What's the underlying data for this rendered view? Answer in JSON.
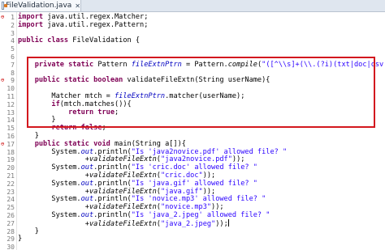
{
  "editor": {
    "tab": {
      "label": "FileValidation.java",
      "close_glyph": "✕"
    },
    "lines": [
      {
        "num": "1",
        "marker": "⊖",
        "tokens": [
          {
            "t": "import ",
            "c": "kw"
          },
          {
            "t": "java.util.regex.Matcher;",
            "c": ""
          }
        ]
      },
      {
        "num": "2",
        "marker": "",
        "tokens": [
          {
            "t": "import ",
            "c": "kw"
          },
          {
            "t": "java.util.regex.Pattern;",
            "c": ""
          }
        ]
      },
      {
        "num": "3",
        "marker": "",
        "tokens": []
      },
      {
        "num": "4",
        "marker": "",
        "tokens": [
          {
            "t": "public class ",
            "c": "kw"
          },
          {
            "t": "FileValidation {",
            "c": ""
          }
        ]
      },
      {
        "num": "5",
        "marker": "",
        "tokens": []
      },
      {
        "num": "6",
        "marker": "",
        "tokens": []
      },
      {
        "num": "7",
        "marker": "",
        "tokens": [
          {
            "t": "    private static ",
            "c": "kw"
          },
          {
            "t": "Pattern ",
            "c": ""
          },
          {
            "t": "fileExtnPtrn",
            "c": "fld"
          },
          {
            "t": " = Pattern.",
            "c": ""
          },
          {
            "t": "compile",
            "c": "stat"
          },
          {
            "t": "(",
            "c": ""
          },
          {
            "t": "\"([^\\\\s]+(\\\\.(?i)(txt|doc|csv|pdf))$)\"",
            "c": "str"
          },
          {
            "t": ");",
            "c": ""
          }
        ]
      },
      {
        "num": "8",
        "marker": "",
        "tokens": []
      },
      {
        "num": "9",
        "marker": "⊖",
        "tokens": [
          {
            "t": "    public static boolean ",
            "c": "kw"
          },
          {
            "t": "validateFileExtn(String userName){",
            "c": ""
          }
        ]
      },
      {
        "num": "10",
        "marker": "",
        "tokens": []
      },
      {
        "num": "11",
        "marker": "",
        "tokens": [
          {
            "t": "        Matcher mtch = ",
            "c": ""
          },
          {
            "t": "fileExtnPtrn",
            "c": "fld"
          },
          {
            "t": ".matcher(userName);",
            "c": ""
          }
        ]
      },
      {
        "num": "12",
        "marker": "",
        "tokens": [
          {
            "t": "        ",
            "c": ""
          },
          {
            "t": "if",
            "c": "kw"
          },
          {
            "t": "(mtch.matches()){",
            "c": ""
          }
        ]
      },
      {
        "num": "13",
        "marker": "",
        "tokens": [
          {
            "t": "            ",
            "c": ""
          },
          {
            "t": "return true",
            "c": "kw"
          },
          {
            "t": ";",
            "c": ""
          }
        ]
      },
      {
        "num": "14",
        "marker": "",
        "tokens": [
          {
            "t": "        }",
            "c": ""
          }
        ]
      },
      {
        "num": "15",
        "marker": "",
        "tokens": [
          {
            "t": "        ",
            "c": ""
          },
          {
            "t": "return false",
            "c": "kw"
          },
          {
            "t": ";",
            "c": ""
          }
        ]
      },
      {
        "num": "16",
        "marker": "",
        "tokens": [
          {
            "t": "    }",
            "c": ""
          }
        ]
      },
      {
        "num": "17",
        "marker": "⊖",
        "tokens": [
          {
            "t": "    public static void ",
            "c": "kw"
          },
          {
            "t": "main(String a[]){",
            "c": ""
          }
        ]
      },
      {
        "num": "18",
        "marker": "",
        "tokens": [
          {
            "t": "        System.",
            "c": ""
          },
          {
            "t": "out",
            "c": "fld"
          },
          {
            "t": ".println(",
            "c": ""
          },
          {
            "t": "\"Is 'java2novice.pdf' allowed file? \"",
            "c": "str"
          }
        ]
      },
      {
        "num": "19",
        "marker": "",
        "tokens": [
          {
            "t": "                +",
            "c": ""
          },
          {
            "t": "validateFileExtn",
            "c": "stat"
          },
          {
            "t": "(",
            "c": ""
          },
          {
            "t": "\"java2novice.pdf\"",
            "c": "str"
          },
          {
            "t": "));",
            "c": ""
          }
        ]
      },
      {
        "num": "20",
        "marker": "",
        "tokens": [
          {
            "t": "        System.",
            "c": ""
          },
          {
            "t": "out",
            "c": "fld"
          },
          {
            "t": ".println(",
            "c": ""
          },
          {
            "t": "\"Is 'cric.doc' allowed file? \"",
            "c": "str"
          }
        ]
      },
      {
        "num": "21",
        "marker": "",
        "tokens": [
          {
            "t": "                +",
            "c": ""
          },
          {
            "t": "validateFileExtn",
            "c": "stat"
          },
          {
            "t": "(",
            "c": ""
          },
          {
            "t": "\"cric.doc\"",
            "c": "str"
          },
          {
            "t": "));",
            "c": ""
          }
        ]
      },
      {
        "num": "22",
        "marker": "",
        "tokens": [
          {
            "t": "        System.",
            "c": ""
          },
          {
            "t": "out",
            "c": "fld"
          },
          {
            "t": ".println(",
            "c": ""
          },
          {
            "t": "\"Is 'java.gif' allowed file? \"",
            "c": "str"
          }
        ]
      },
      {
        "num": "23",
        "marker": "",
        "tokens": [
          {
            "t": "                +",
            "c": ""
          },
          {
            "t": "validateFileExtn",
            "c": "stat"
          },
          {
            "t": "(",
            "c": ""
          },
          {
            "t": "\"java.gif\"",
            "c": "str"
          },
          {
            "t": "));",
            "c": ""
          }
        ]
      },
      {
        "num": "24",
        "marker": "",
        "tokens": [
          {
            "t": "        System.",
            "c": ""
          },
          {
            "t": "out",
            "c": "fld"
          },
          {
            "t": ".println(",
            "c": ""
          },
          {
            "t": "\"Is 'novice.mp3' allowed file? \"",
            "c": "str"
          }
        ]
      },
      {
        "num": "25",
        "marker": "",
        "tokens": [
          {
            "t": "                +",
            "c": ""
          },
          {
            "t": "validateFileExtn",
            "c": "stat"
          },
          {
            "t": "(",
            "c": ""
          },
          {
            "t": "\"novice.mp3\"",
            "c": "str"
          },
          {
            "t": "));",
            "c": ""
          }
        ]
      },
      {
        "num": "26",
        "marker": "",
        "tokens": [
          {
            "t": "        System.",
            "c": ""
          },
          {
            "t": "out",
            "c": "fld"
          },
          {
            "t": ".println(",
            "c": ""
          },
          {
            "t": "\"Is 'java_2.jpeg' allowed file? \"",
            "c": "str"
          }
        ]
      },
      {
        "num": "27",
        "marker": "",
        "tokens": [
          {
            "t": "                +",
            "c": ""
          },
          {
            "t": "validateFileExtn",
            "c": "stat"
          },
          {
            "t": "(",
            "c": ""
          },
          {
            "t": "\"java_2.jpeg\"",
            "c": "str"
          },
          {
            "t": "));",
            "c": ""
          }
        ]
      },
      {
        "num": "28",
        "marker": "",
        "tokens": [
          {
            "t": "    }",
            "c": ""
          }
        ]
      },
      {
        "num": "29",
        "marker": "",
        "tokens": [
          {
            "t": "}",
            "c": ""
          }
        ]
      },
      {
        "num": "30",
        "marker": "",
        "tokens": []
      }
    ],
    "colors": {
      "keyword": "#7f0055",
      "string": "#2a00ff",
      "field": "#0000c0",
      "highlight_border": "#d3181e"
    },
    "cursor_line": "27"
  }
}
